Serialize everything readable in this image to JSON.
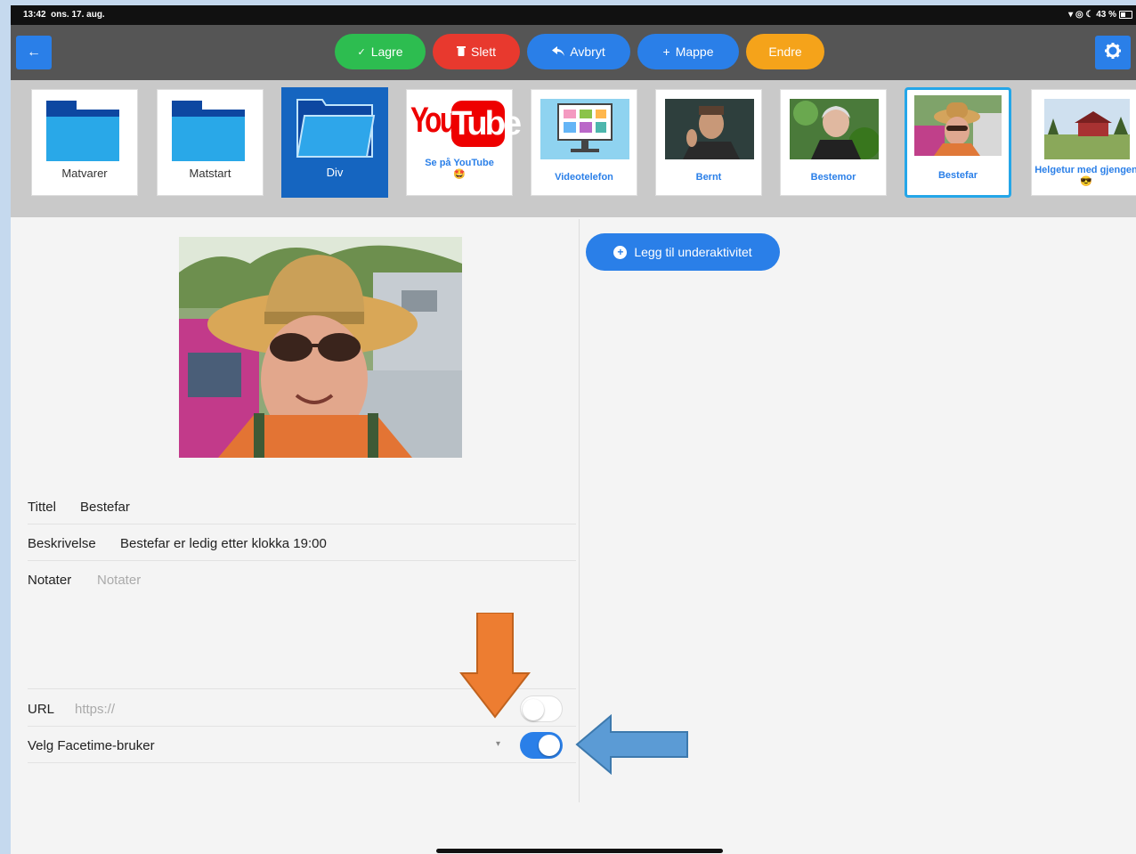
{
  "status_bar": {
    "time": "13:42",
    "date": "ons. 17. aug.",
    "battery": "43 %"
  },
  "toolbar": {
    "back_icon": "←",
    "buttons": [
      {
        "icon": "✓",
        "label": "Lagre",
        "color": "#2dbd50"
      },
      {
        "icon": "🗑",
        "label": "Slett",
        "color": "#e8392e"
      },
      {
        "icon": "↩",
        "label": "Avbryt",
        "color": "#2a7fe8"
      },
      {
        "icon": "+",
        "label": "Mappe",
        "color": "#2a7fe8"
      },
      {
        "icon": "",
        "label": "Endre",
        "color": "#f5a31a"
      }
    ]
  },
  "strip": {
    "items": [
      {
        "label": "Matvarer",
        "kind": "folder"
      },
      {
        "label": "Matstart",
        "kind": "folder"
      },
      {
        "label": "Div",
        "kind": "folder-open"
      },
      {
        "label": "Se på YouTube",
        "emoji": "🤩",
        "kind": "youtube"
      },
      {
        "label": "Videotelefon",
        "kind": "monitor"
      },
      {
        "label": "Bernt",
        "kind": "photo"
      },
      {
        "label": "Bestemor",
        "kind": "photo"
      },
      {
        "label": "Bestefar",
        "kind": "photo",
        "selected": true
      },
      {
        "label": "Helgetur med gjengen",
        "emoji": "😎",
        "kind": "photo"
      }
    ],
    "youtube_logo": {
      "left": "You",
      "right": "Tube"
    }
  },
  "form": {
    "title_label": "Tittel",
    "title_value": "Bestefar",
    "description_label": "Beskrivelse",
    "description_value": "Bestefar er ledig etter klokka 19:00",
    "notes_label": "Notater",
    "notes_placeholder": "Notater",
    "url_label": "URL",
    "url_placeholder": "https://",
    "url_toggle_on": false,
    "facetime_label": "Velg Facetime-bruker",
    "facetime_toggle_on": true
  },
  "right_panel": {
    "add_sub_label": "Legg til underaktivitet"
  },
  "colors": {
    "accent": "#2a7fe8",
    "selected_border": "#24a6e8",
    "orange_arrow": "#ed7d31",
    "blue_arrow": "#5b9bd5"
  }
}
